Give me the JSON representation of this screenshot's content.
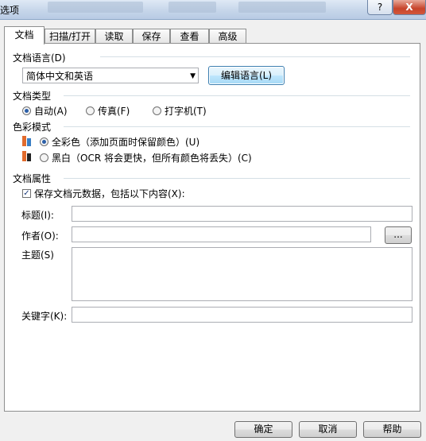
{
  "window": {
    "title": "选项",
    "help_glyph": "?",
    "close_glyph": "X"
  },
  "tabs": [
    {
      "label": "文档",
      "active": true
    },
    {
      "label": "扫描/打开",
      "active": false
    },
    {
      "label": "读取",
      "active": false
    },
    {
      "label": "保存",
      "active": false
    },
    {
      "label": "查看",
      "active": false
    },
    {
      "label": "高级",
      "active": false
    }
  ],
  "document_language": {
    "group_label": "文档语言(D)",
    "selected": "简体中文和英语",
    "edit_button": "编辑语言(L)"
  },
  "document_type": {
    "group_label": "文档类型",
    "options": [
      {
        "label": "自动(A)",
        "checked": true
      },
      {
        "label": "传真(F)",
        "checked": false
      },
      {
        "label": "打字机(T)",
        "checked": false
      }
    ]
  },
  "color_mode": {
    "group_label": "色彩模式",
    "options": [
      {
        "label": "全彩色（添加页面时保留颜色）(U)",
        "checked": true
      },
      {
        "label": "黑白（OCR 将会更快，但所有颜色将丢失）(C)",
        "checked": false
      }
    ]
  },
  "document_properties": {
    "group_label": "文档属性",
    "save_metadata_label": "保存文档元数据，包括以下内容(X):",
    "save_metadata_checked": true,
    "title_label": "标题(I):",
    "title_value": "",
    "author_label": "作者(O):",
    "author_value": "",
    "browse_button": "...",
    "subject_label": "主题(S)",
    "subject_value": "",
    "keywords_label": "关键字(K):",
    "keywords_value": ""
  },
  "footer": {
    "ok": "确定",
    "cancel": "取消",
    "help": "帮助"
  },
  "colors": {
    "accent": "#3c7fb1",
    "panel_bg": "#ffffff",
    "window_bg": "#f0f0f0"
  }
}
